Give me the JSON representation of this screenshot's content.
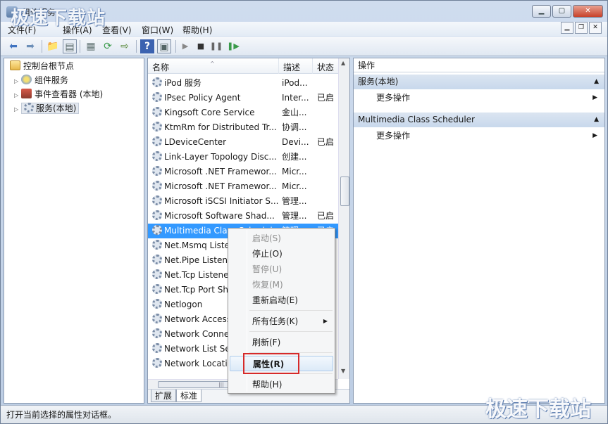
{
  "window": {
    "title": "组件服务"
  },
  "watermark": {
    "top": "极速下载站",
    "bottom": "极速下载站"
  },
  "menubar": {
    "items": [
      "文件(F)",
      "操作(A)",
      "查看(V)",
      "窗口(W)",
      "帮助(H)"
    ]
  },
  "toolbar": {
    "icons": [
      "back-icon",
      "forward-icon",
      "up-icon",
      "show-hide-tree-icon",
      "export-icon",
      "refresh-icon",
      "export-list-icon",
      "help-icon",
      "properties-icon",
      "play-icon",
      "stop-icon",
      "pause-icon",
      "restart-icon"
    ]
  },
  "tree": {
    "root": "控制台根节点",
    "items": [
      "组件服务",
      "事件查看器 (本地)",
      "服务(本地)"
    ]
  },
  "list": {
    "columns": {
      "name": "名称",
      "desc": "描述",
      "status": "状态"
    },
    "rows": [
      {
        "name": "iPod 服务",
        "desc": "iPod...",
        "status": ""
      },
      {
        "name": "IPsec Policy Agent",
        "desc": "Inter...",
        "status": "已启"
      },
      {
        "name": "Kingsoft Core Service",
        "desc": "金山...",
        "status": ""
      },
      {
        "name": "KtmRm for Distributed Tr...",
        "desc": "协调...",
        "status": ""
      },
      {
        "name": "LDeviceCenter",
        "desc": "Devi...",
        "status": "已启"
      },
      {
        "name": "Link-Layer Topology Disc...",
        "desc": "创建...",
        "status": ""
      },
      {
        "name": "Microsoft .NET Framewor...",
        "desc": "Micr...",
        "status": ""
      },
      {
        "name": "Microsoft .NET Framewor...",
        "desc": "Micr...",
        "status": ""
      },
      {
        "name": "Microsoft iSCSI Initiator S...",
        "desc": "管理...",
        "status": ""
      },
      {
        "name": "Microsoft Software Shad...",
        "desc": "管理...",
        "status": "已启"
      },
      {
        "name": "Multimedia Class Schedul...",
        "desc": "管理...",
        "status": "已启"
      },
      {
        "name": "Net.Msmq Listener Adapter",
        "desc": "",
        "status": ""
      },
      {
        "name": "Net.Pipe Listener Adapter",
        "desc": "",
        "status": ""
      },
      {
        "name": "Net.Tcp Listener Adapter",
        "desc": "",
        "status": ""
      },
      {
        "name": "Net.Tcp Port Sharing Service",
        "desc": "",
        "status": ""
      },
      {
        "name": "Netlogon",
        "desc": "",
        "status": ""
      },
      {
        "name": "Network Access Protection",
        "desc": "",
        "status": ""
      },
      {
        "name": "Network Connections",
        "desc": "",
        "status": ""
      },
      {
        "name": "Network List Service",
        "desc": "",
        "status": ""
      },
      {
        "name": "Network Location Awareness",
        "desc": "",
        "status": ""
      }
    ],
    "tabs": [
      "扩展",
      "标准"
    ]
  },
  "actions": {
    "title": "操作",
    "group1": "服务(本地)",
    "group1_item": "更多操作",
    "group2": "Multimedia Class Scheduler",
    "group2_item": "更多操作"
  },
  "context_menu": {
    "start": "启动(S)",
    "stop": "停止(O)",
    "pause": "暂停(U)",
    "resume": "恢复(M)",
    "restart": "重新启动(E)",
    "all_tasks": "所有任务(K)",
    "refresh": "刷新(F)",
    "properties": "属性(R)",
    "help": "帮助(H)"
  },
  "status": {
    "text": "打开当前选择的属性对话框。"
  }
}
